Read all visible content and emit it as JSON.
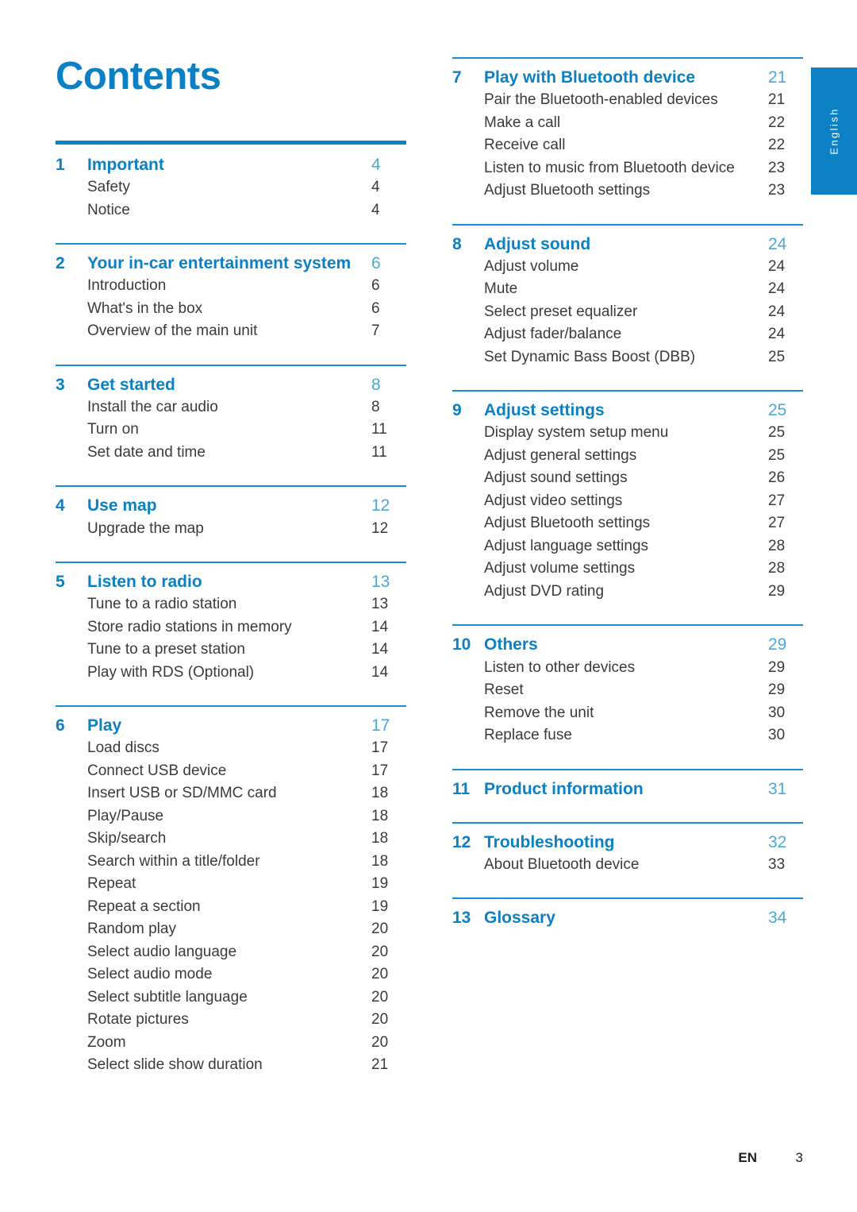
{
  "document": {
    "title": "Contents",
    "language_tab": "English",
    "footer": {
      "language_code": "EN",
      "page_number": "3"
    },
    "colors": {
      "heading_blue": "#0b80c4",
      "rule_blue": "#1a8fcd",
      "page_num_blue": "#4aa8d8",
      "body_text": "#3a3a3c"
    }
  },
  "columns": [
    {
      "id": "left",
      "sections": [
        {
          "number": "1",
          "title": "Important",
          "page": "4",
          "entries": [
            {
              "title": "Safety",
              "page": "4"
            },
            {
              "title": "Notice",
              "page": "4"
            }
          ]
        },
        {
          "number": "2",
          "title": "Your in-car entertainment system",
          "page": "6",
          "entries": [
            {
              "title": "Introduction",
              "page": "6"
            },
            {
              "title": "What's in the box",
              "page": "6"
            },
            {
              "title": "Overview of the main unit",
              "page": "7"
            }
          ]
        },
        {
          "number": "3",
          "title": "Get started",
          "page": "8",
          "entries": [
            {
              "title": "Install the car audio",
              "page": "8"
            },
            {
              "title": "Turn on",
              "page": "11"
            },
            {
              "title": "Set date and time",
              "page": "11"
            }
          ]
        },
        {
          "number": "4",
          "title": "Use map",
          "page": "12",
          "entries": [
            {
              "title": "Upgrade the map",
              "page": "12"
            }
          ]
        },
        {
          "number": "5",
          "title": "Listen to radio",
          "page": "13",
          "entries": [
            {
              "title": "Tune to a radio station",
              "page": "13"
            },
            {
              "title": "Store radio stations in memory",
              "page": "14"
            },
            {
              "title": "Tune to a preset station",
              "page": "14"
            },
            {
              "title": "Play with RDS (Optional)",
              "page": "14"
            }
          ]
        },
        {
          "number": "6",
          "title": "Play",
          "page": "17",
          "entries": [
            {
              "title": "Load discs",
              "page": "17"
            },
            {
              "title": "Connect USB device",
              "page": "17"
            },
            {
              "title": "Insert USB or SD/MMC card",
              "page": "18"
            },
            {
              "title": "Play/Pause",
              "page": "18"
            },
            {
              "title": "Skip/search",
              "page": "18"
            },
            {
              "title": "Search within a title/folder",
              "page": "18"
            },
            {
              "title": "Repeat",
              "page": "19"
            },
            {
              "title": "Repeat a section",
              "page": "19"
            },
            {
              "title": "Random play",
              "page": "20"
            },
            {
              "title": "Select audio language",
              "page": "20"
            },
            {
              "title": "Select audio mode",
              "page": "20"
            },
            {
              "title": "Select subtitle language",
              "page": "20"
            },
            {
              "title": "Rotate pictures",
              "page": "20"
            },
            {
              "title": "Zoom",
              "page": "20"
            },
            {
              "title": "Select slide show duration",
              "page": "21"
            }
          ]
        }
      ]
    },
    {
      "id": "right",
      "sections": [
        {
          "number": "7",
          "title": "Play with Bluetooth device",
          "page": "21",
          "entries": [
            {
              "title": "Pair the Bluetooth-enabled devices",
              "page": "21"
            },
            {
              "title": "Make a call",
              "page": "22"
            },
            {
              "title": "Receive call",
              "page": "22"
            },
            {
              "title": "Listen to music from Bluetooth device",
              "page": "23"
            },
            {
              "title": "Adjust Bluetooth settings",
              "page": "23"
            }
          ]
        },
        {
          "number": "8",
          "title": "Adjust sound",
          "page": "24",
          "entries": [
            {
              "title": "Adjust volume",
              "page": "24"
            },
            {
              "title": "Mute",
              "page": "24"
            },
            {
              "title": "Select preset equalizer",
              "page": "24"
            },
            {
              "title": "Adjust fader/balance",
              "page": "24"
            },
            {
              "title": "Set Dynamic Bass Boost (DBB)",
              "page": "25"
            }
          ]
        },
        {
          "number": "9",
          "title": "Adjust settings",
          "page": "25",
          "entries": [
            {
              "title": "Display system setup menu",
              "page": "25"
            },
            {
              "title": "Adjust general settings",
              "page": "25"
            },
            {
              "title": "Adjust sound settings",
              "page": "26"
            },
            {
              "title": "Adjust video settings",
              "page": "27"
            },
            {
              "title": "Adjust Bluetooth settings",
              "page": "27"
            },
            {
              "title": "Adjust language settings",
              "page": "28"
            },
            {
              "title": "Adjust volume settings",
              "page": "28"
            },
            {
              "title": "Adjust DVD rating",
              "page": "29"
            }
          ]
        },
        {
          "number": "10",
          "title": "Others",
          "page": "29",
          "entries": [
            {
              "title": "Listen to other devices",
              "page": "29"
            },
            {
              "title": "Reset",
              "page": "29"
            },
            {
              "title": "Remove the unit",
              "page": "30"
            },
            {
              "title": "Replace fuse",
              "page": "30"
            }
          ]
        },
        {
          "number": "11",
          "title": "Product information",
          "page": "31",
          "entries": []
        },
        {
          "number": "12",
          "title": "Troubleshooting",
          "page": "32",
          "entries": [
            {
              "title": "About Bluetooth device",
              "page": "33"
            }
          ]
        },
        {
          "number": "13",
          "title": "Glossary",
          "page": "34",
          "entries": []
        }
      ]
    }
  ]
}
